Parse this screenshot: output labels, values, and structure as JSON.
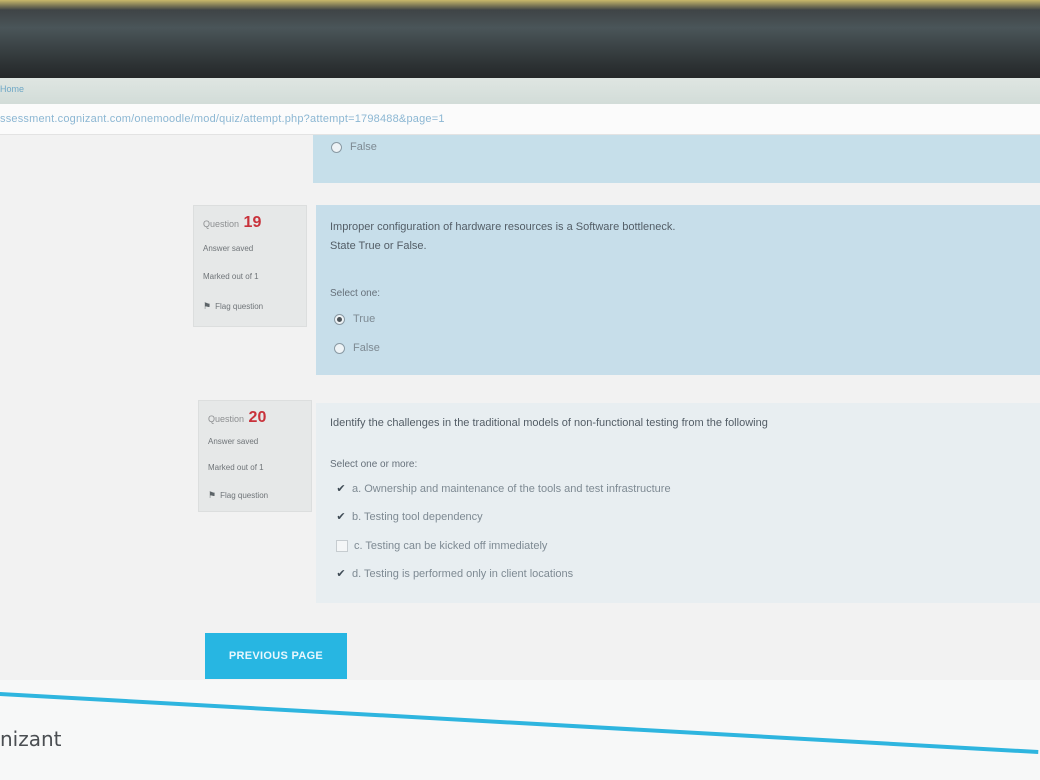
{
  "browser": {
    "tab_title": "Home",
    "url": "ssessment.cognizant.com/onemoodle/mod/quiz/attempt.php?attempt=1798488&page=1"
  },
  "previous_question": {
    "visible_option": "False"
  },
  "questions": [
    {
      "label": "Question",
      "number": "19",
      "status": "Answer saved",
      "marks": "Marked out of 1",
      "flag": "Flag question",
      "text_line1": "Improper configuration of hardware resources is a Software bottleneck.",
      "text_line2": "State True or False.",
      "select_label": "Select one:",
      "options": [
        {
          "label": "True",
          "checked": true
        },
        {
          "label": "False",
          "checked": false
        }
      ]
    },
    {
      "label": "Question",
      "number": "20",
      "status": "Answer saved",
      "marks": "Marked out of 1",
      "flag": "Flag question",
      "text_line1": "Identify the challenges in the traditional models of non-functional testing from the following",
      "select_label": "Select one or more:",
      "options": [
        {
          "label": "a. Ownership and maintenance of the tools and test infrastructure",
          "checked": true
        },
        {
          "label": "b. Testing tool dependency",
          "checked": true
        },
        {
          "label": "c. Testing can be kicked off immediately",
          "checked": false
        },
        {
          "label": "d. Testing is performed only in client locations",
          "checked": true
        }
      ]
    }
  ],
  "navigation": {
    "previous_page": "PREVIOUS PAGE"
  },
  "footer": {
    "brand": "nizant"
  },
  "colors": {
    "accent": "#27b6e2",
    "question_number": "#c9323b",
    "answered_bg": "#c7deea"
  }
}
